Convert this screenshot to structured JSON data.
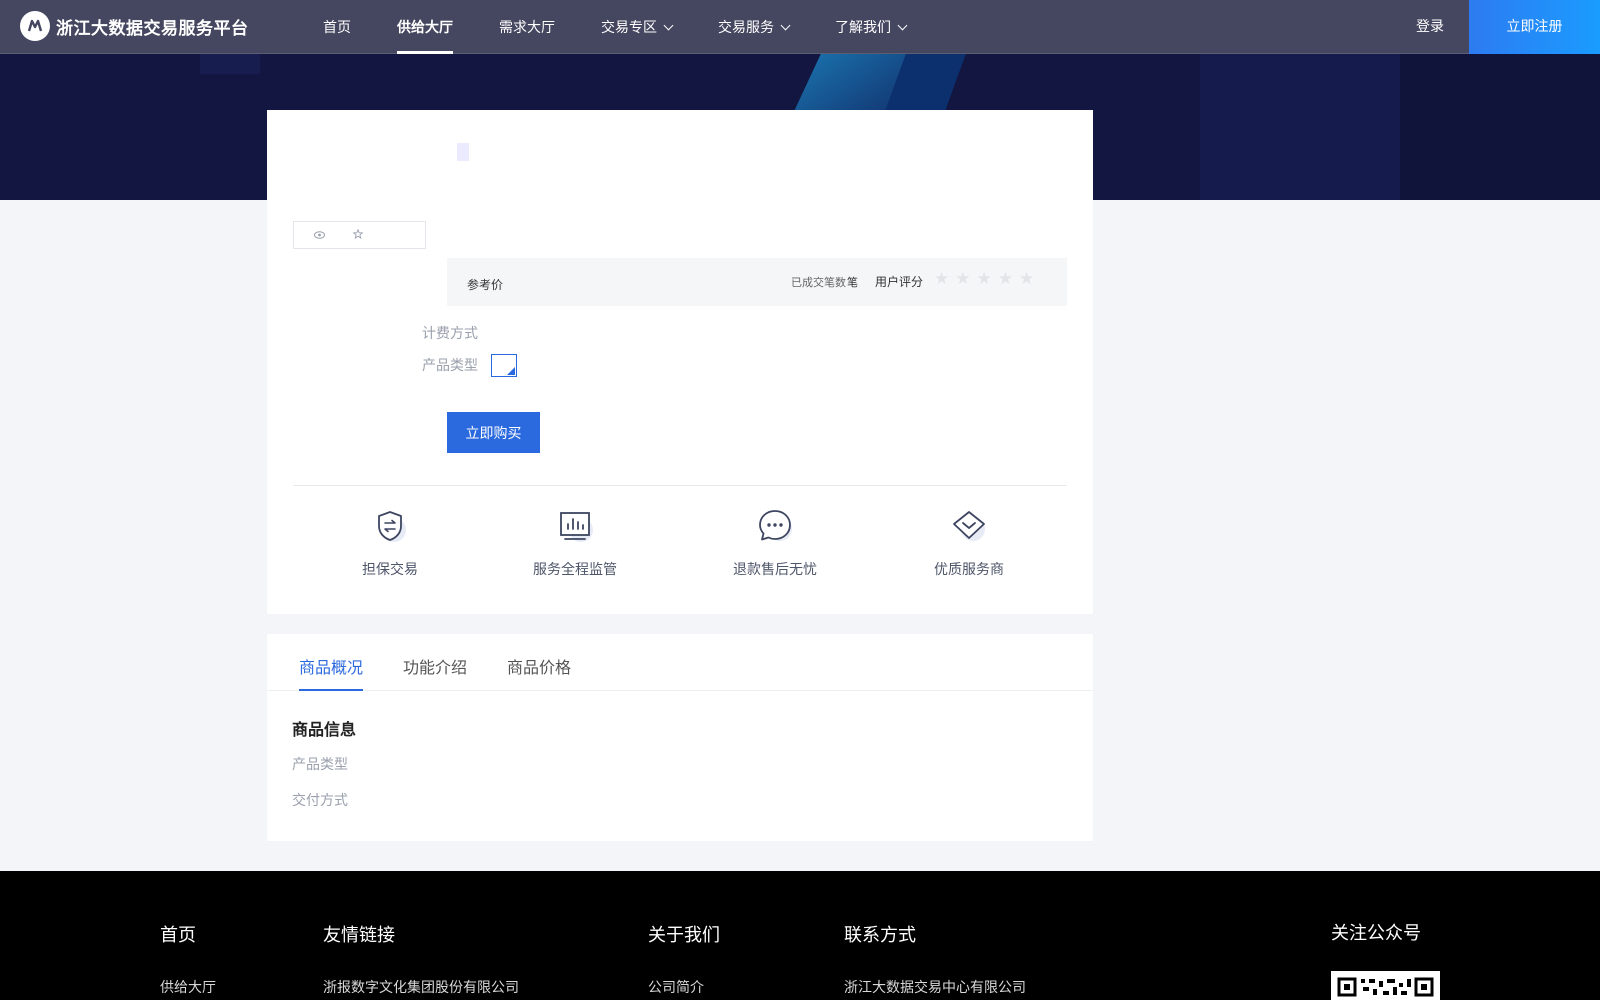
{
  "brand": {
    "name": "浙江大数据交易服务平台"
  },
  "nav": {
    "items": [
      {
        "label": "首页",
        "active": false,
        "dropdown": false
      },
      {
        "label": "供给大厅",
        "active": true,
        "dropdown": false
      },
      {
        "label": "需求大厅",
        "active": false,
        "dropdown": false
      },
      {
        "label": "交易专区",
        "active": false,
        "dropdown": true
      },
      {
        "label": "交易服务",
        "active": false,
        "dropdown": true
      },
      {
        "label": "了解我们",
        "active": false,
        "dropdown": true
      }
    ],
    "login": "登录",
    "register": "立即注册"
  },
  "product": {
    "reference_price_label": "参考价",
    "deals_label": "已成交笔数",
    "deals_unit": "笔",
    "rating_label": "用户评分",
    "rating_stars": 5,
    "rating_value": 0,
    "billing_label": "计费方式",
    "type_label": "产品类型",
    "buy_button": "立即购买"
  },
  "guarantees": [
    {
      "label": "担保交易",
      "icon": "shield-exchange-icon"
    },
    {
      "label": "服务全程监管",
      "icon": "monitor-chart-icon"
    },
    {
      "label": "退款售后无忧",
      "icon": "chat-bubble-icon"
    },
    {
      "label": "优质服务商",
      "icon": "diamond-icon"
    }
  ],
  "tabs": [
    {
      "label": "商品概况",
      "active": true
    },
    {
      "label": "功能介绍",
      "active": false
    },
    {
      "label": "商品价格",
      "active": false
    }
  ],
  "info": {
    "title": "商品信息",
    "product_type_label": "产品类型",
    "delivery_label": "交付方式"
  },
  "footer": {
    "col1": {
      "head": "首页",
      "link": "供给大厅"
    },
    "col2": {
      "head": "友情链接",
      "link": "浙报数字文化集团股份有限公司"
    },
    "col3": {
      "head": "关于我们",
      "link": "公司简介"
    },
    "col4": {
      "head": "联系方式",
      "link": "浙江大数据交易中心有限公司"
    },
    "col5": {
      "head": "关注公众号"
    }
  },
  "colors": {
    "primary": "#2b6ade",
    "header_bg": "#44475f",
    "hero_bg": "#121640",
    "footer_bg": "#000000"
  }
}
